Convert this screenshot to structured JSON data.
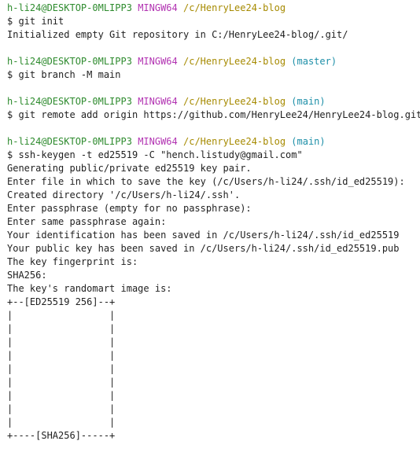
{
  "colors": {
    "background": "#ffffff",
    "text": "#1f1f1f",
    "user_host": "#2e8b2e",
    "mingw": "#b233b2",
    "path": "#a68a00",
    "branch": "#1d8fa8"
  },
  "blocks": [
    {
      "prompt": {
        "user_host": "h-li24@DESKTOP-0MLIPP3",
        "env": "MINGW64",
        "path": "/c/HenryLee24-blog",
        "branch": ""
      },
      "command": "$ git init",
      "output": [
        "Initialized empty Git repository in C:/HenryLee24-blog/.git/"
      ]
    },
    {
      "prompt": {
        "user_host": "h-li24@DESKTOP-0MLIPP3",
        "env": "MINGW64",
        "path": "/c/HenryLee24-blog",
        "branch": "(master)"
      },
      "command": "$ git branch -M main",
      "output": []
    },
    {
      "prompt": {
        "user_host": "h-li24@DESKTOP-0MLIPP3",
        "env": "MINGW64",
        "path": "/c/HenryLee24-blog",
        "branch": "(main)"
      },
      "command": "$ git remote add origin https://github.com/HenryLee24/HenryLee24-blog.git",
      "output": []
    },
    {
      "prompt": {
        "user_host": "h-li24@DESKTOP-0MLIPP3",
        "env": "MINGW64",
        "path": "/c/HenryLee24-blog",
        "branch": "(main)"
      },
      "command": "$ ssh-keygen -t ed25519 -C \"hench.listudy@gmail.com\"",
      "output": [
        "Generating public/private ed25519 key pair.",
        "Enter file in which to save the key (/c/Users/h-li24/.ssh/id_ed25519):",
        "Created directory '/c/Users/h-li24/.ssh'.",
        "Enter passphrase (empty for no passphrase):",
        "Enter same passphrase again:",
        "Your identification has been saved in /c/Users/h-li24/.ssh/id_ed25519",
        "Your public key has been saved in /c/Users/h-li24/.ssh/id_ed25519.pub",
        "The key fingerprint is:",
        "SHA256:",
        "The key's randomart image is:",
        "+--[ED25519 256]--+",
        "|                 |",
        "|                 |",
        "|                 |",
        "|                 |",
        "|                 |",
        "|                 |",
        "|                 |",
        "|                 |",
        "|                 |",
        "+----[SHA256]-----+"
      ]
    }
  ]
}
